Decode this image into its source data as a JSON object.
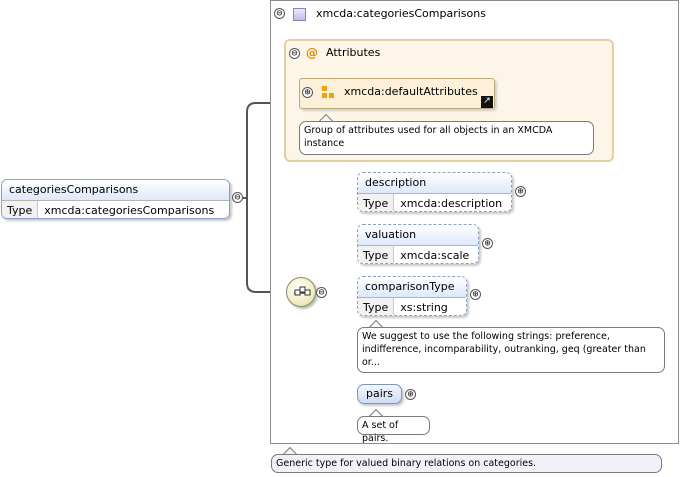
{
  "root": {
    "name": "categoriesComparisons",
    "type_key": "Type",
    "type_value": "xmcda:categoriesComparisons"
  },
  "complex_type": {
    "name": "xmcda:categoriesComparisons",
    "note": "Generic type for valued binary relations on categories."
  },
  "attributes": {
    "label": "Attributes",
    "group": "xmcda:defaultAttributes",
    "group_note": "Group of attributes used for all objects in an XMCDA instance"
  },
  "elements": [
    {
      "name": "description",
      "type_key": "Type",
      "type_value": "xmcda:description"
    },
    {
      "name": "valuation",
      "type_key": "Type",
      "type_value": "xmcda:scale"
    },
    {
      "name": "comparisonType",
      "type_key": "Type",
      "type_value": "xs:string",
      "note": "We suggest to use the following strings: preference, indifference, incomparability, outranking, geq (greater than or..."
    },
    {
      "name": "pairs",
      "note": "A set of pairs."
    }
  ],
  "symbols": {
    "collapse": "⊖",
    "expand": "⊕",
    "attribute": "@"
  },
  "colors": {
    "element_header": "#dde8fb",
    "attributes_bg": "#fdf6e8",
    "group_bg": "#fdf0d8",
    "type_icon": "#c5bce6",
    "group_icon": "#f0a010"
  }
}
